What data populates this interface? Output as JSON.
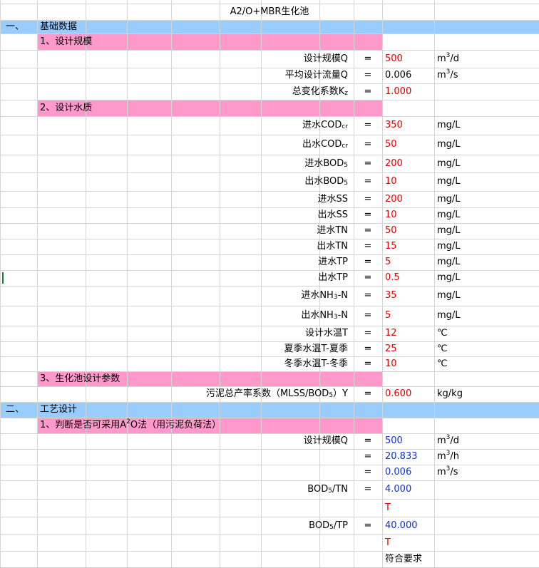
{
  "title": "A2/O+MBR生化池",
  "colors": {
    "section_band": "#99ccff",
    "subsection_band": "#ff99cc",
    "red_value": "#e00000",
    "blue_value": "#1030d0",
    "gridline": "#d4d4d4"
  },
  "sections": [
    {
      "num": "一、",
      "label": "基础数据"
    },
    {
      "num": "二、",
      "label": "工艺设计"
    }
  ],
  "subsections": [
    {
      "label": "1、设计规模"
    },
    {
      "label": "2、设计水质"
    },
    {
      "label": "3、生化池设计参数"
    },
    {
      "pre": "1、判断是否可采用A",
      "sup": "2",
      "post": "O法（用污泥负荷法）"
    }
  ],
  "rows": [
    {
      "id": "r3",
      "label": {
        "main": "设计规模Q"
      },
      "eq": "=",
      "value": "500",
      "vcolor": "red",
      "unit": {
        "a": "m",
        "sup": "3",
        "b": "/d"
      }
    },
    {
      "id": "r4",
      "label": {
        "main": "平均设计流量Q"
      },
      "eq": "=",
      "value": "0.006",
      "vcolor": "black",
      "unit": {
        "a": "m",
        "sup": "3",
        "b": "/s"
      }
    },
    {
      "id": "r5",
      "label": {
        "main": "总变化系数K",
        "sub": "z"
      },
      "eq": "=",
      "value": "1.000",
      "vcolor": "red",
      "unit": {
        "a": ""
      }
    },
    {
      "id": "r7",
      "label": {
        "main": "进水COD",
        "sub": "cr"
      },
      "eq": "=",
      "value": "350",
      "vcolor": "red",
      "unit": {
        "a": "mg/L"
      }
    },
    {
      "id": "r8",
      "label": {
        "main": "出水COD",
        "sub": "cr"
      },
      "eq": "=",
      "value": "50",
      "vcolor": "red",
      "unit": {
        "a": "mg/L"
      }
    },
    {
      "id": "r9",
      "label": {
        "main": "进水BOD",
        "sub": "5"
      },
      "eq": "=",
      "value": "200",
      "vcolor": "red",
      "unit": {
        "a": "mg/L"
      }
    },
    {
      "id": "r10",
      "label": {
        "main": "出水BOD",
        "sub": "5"
      },
      "eq": "=",
      "value": "10",
      "vcolor": "red",
      "unit": {
        "a": "mg/L"
      }
    },
    {
      "id": "r11",
      "label": {
        "main": "进水SS"
      },
      "eq": "=",
      "value": "200",
      "vcolor": "red",
      "unit": {
        "a": "mg/L"
      }
    },
    {
      "id": "r12",
      "label": {
        "main": "出水SS"
      },
      "eq": "=",
      "value": "10",
      "vcolor": "red",
      "unit": {
        "a": "mg/L"
      }
    },
    {
      "id": "r13",
      "label": {
        "main": "进水TN"
      },
      "eq": "=",
      "value": "50",
      "vcolor": "red",
      "unit": {
        "a": "mg/L"
      }
    },
    {
      "id": "r14",
      "label": {
        "main": "出水TN"
      },
      "eq": "=",
      "value": "15",
      "vcolor": "red",
      "unit": {
        "a": "mg/L"
      }
    },
    {
      "id": "r15",
      "label": {
        "main": "进水TP"
      },
      "eq": "=",
      "value": "5",
      "vcolor": "red",
      "unit": {
        "a": "mg/L"
      }
    },
    {
      "id": "r16",
      "label": {
        "main": "出水TP"
      },
      "eq": "=",
      "value": "0.5",
      "vcolor": "red",
      "unit": {
        "a": "mg/L"
      }
    },
    {
      "id": "r17",
      "label": {
        "main": "进水NH",
        "sub": "3",
        "post": "-N"
      },
      "eq": "=",
      "value": "35",
      "vcolor": "red",
      "unit": {
        "a": "mg/L"
      }
    },
    {
      "id": "r18",
      "label": {
        "main": "出水NH",
        "sub": "3",
        "post": "-N"
      },
      "eq": "=",
      "value": "5",
      "vcolor": "red",
      "unit": {
        "a": "mg/L"
      }
    },
    {
      "id": "r19",
      "label": {
        "main": "设计水温T"
      },
      "eq": "=",
      "value": "12",
      "vcolor": "red",
      "unit": {
        "a": "℃"
      }
    },
    {
      "id": "r20",
      "label": {
        "main": "夏季水温T-夏季"
      },
      "eq": "=",
      "value": "25",
      "vcolor": "red",
      "unit": {
        "a": "℃"
      }
    },
    {
      "id": "r21",
      "label": {
        "main": "冬季水温T-冬季"
      },
      "eq": "=",
      "value": "10",
      "vcolor": "red",
      "unit": {
        "a": "℃"
      }
    },
    {
      "id": "r23",
      "label": {
        "main": "污泥总产率系数（MLSS/BOD",
        "sub": "5",
        "post": "）Y"
      },
      "eq": "=",
      "value": "0.600",
      "vcolor": "red",
      "unit": {
        "a": "kg/kg"
      }
    },
    {
      "id": "r26",
      "label": {
        "main": "设计规模Q"
      },
      "eq": "=",
      "value": "500",
      "vcolor": "blue",
      "unit": {
        "a": "m",
        "sup": "3",
        "b": "/d"
      }
    },
    {
      "id": "r27",
      "label": {
        "main": ""
      },
      "eq": "=",
      "value": "20.833",
      "vcolor": "blue",
      "unit": {
        "a": "m",
        "sup": "3",
        "b": "/h"
      }
    },
    {
      "id": "r28",
      "label": {
        "main": ""
      },
      "eq": "=",
      "value": "0.006",
      "vcolor": "blue",
      "unit": {
        "a": "m",
        "sup": "3",
        "b": "/s"
      }
    },
    {
      "id": "r29",
      "label": {
        "main": "BOD",
        "sub": "5",
        "post": "/TN"
      },
      "eq": "=",
      "value": "4.000",
      "vcolor": "blue",
      "unit": {
        "a": ""
      }
    },
    {
      "id": "r30",
      "label": {
        "main": ""
      },
      "eq": "",
      "value": "T",
      "vcolor": "red",
      "unit": {
        "a": ""
      }
    },
    {
      "id": "r31",
      "label": {
        "main": "BOD",
        "sub": "5",
        "post": "/TP"
      },
      "eq": "=",
      "value": "40.000",
      "vcolor": "blue",
      "unit": {
        "a": ""
      }
    },
    {
      "id": "r32",
      "label": {
        "main": ""
      },
      "eq": "",
      "value": "T",
      "vcolor": "red",
      "unit": {
        "a": ""
      }
    },
    {
      "id": "r33",
      "label": {
        "main": ""
      },
      "eq": "",
      "value": "符合要求",
      "vcolor": "black",
      "unit": {
        "a": ""
      }
    }
  ]
}
